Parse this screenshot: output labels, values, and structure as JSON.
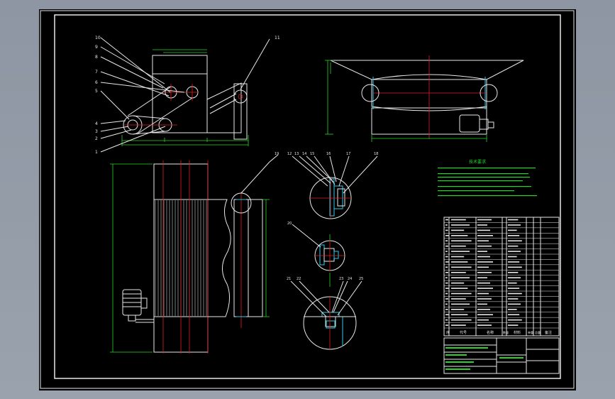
{
  "drawing": {
    "tech_notes_title": "技术要求",
    "tech_notes": [
      "",
      "",
      "",
      "",
      "",
      "",
      ""
    ],
    "balloons": {
      "side_view": [
        "10",
        "9",
        "8",
        "7",
        "6",
        "5",
        "4",
        "3",
        "2",
        "1",
        "11"
      ],
      "detail_top": [
        "12",
        "13",
        "14",
        "15",
        "16",
        "17",
        "18",
        "19"
      ],
      "detail_mid": [
        "20"
      ],
      "detail_bottom": [
        "21",
        "22",
        "23",
        "24",
        "25"
      ]
    },
    "bom_header": [
      "序",
      "代号",
      "名称",
      "数量",
      "材料",
      "单重",
      "总重",
      "备注"
    ],
    "bom_rows": 21,
    "title_block": {
      "cells": [
        "",
        "",
        "",
        "",
        "",
        ""
      ]
    }
  },
  "colors": {
    "background": "#000000",
    "outline": "#e8e8e8",
    "dimension": "#28d428",
    "centerline": "#e02020",
    "highlight": "#2ec8e8"
  }
}
